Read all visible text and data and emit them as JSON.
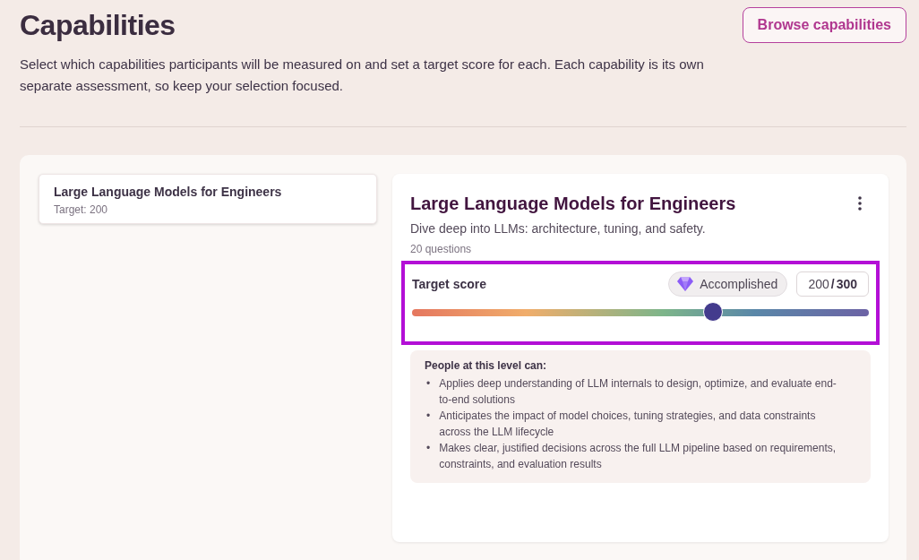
{
  "header": {
    "title": "Capabilities",
    "description": "Select which capabilities participants will be measured on and set a target score for each. Each capability is its own separate assessment, so keep your selection focused.",
    "browse_button": "Browse capabilities"
  },
  "capability_list": [
    {
      "name": "Large Language Models for Engineers",
      "target": "Target: 200",
      "selected": true
    }
  ],
  "detail": {
    "title": "Large Language Models for Engineers",
    "description": "Dive deep into LLMs: architecture, tuning, and safety.",
    "question_count": "20 questions",
    "target_score": {
      "label": "Target score",
      "badge": "Accomplished",
      "value": "200",
      "separator": "/",
      "max": "300",
      "level": 0.66,
      "highlighted": true
    },
    "level_description": {
      "heading": "People at this level can:",
      "bullet": "•",
      "items": [
        "Applies deep understanding of LLM internals to design, optimize, and evaluate end-to-end solutions",
        "Anticipates the impact of model choices, tuning strategies, and data constraints across the LLM lifecycle",
        "Makes clear, justified decisions across the full LLM pipeline based on requirements, constraints, and evaluation results"
      ]
    }
  }
}
